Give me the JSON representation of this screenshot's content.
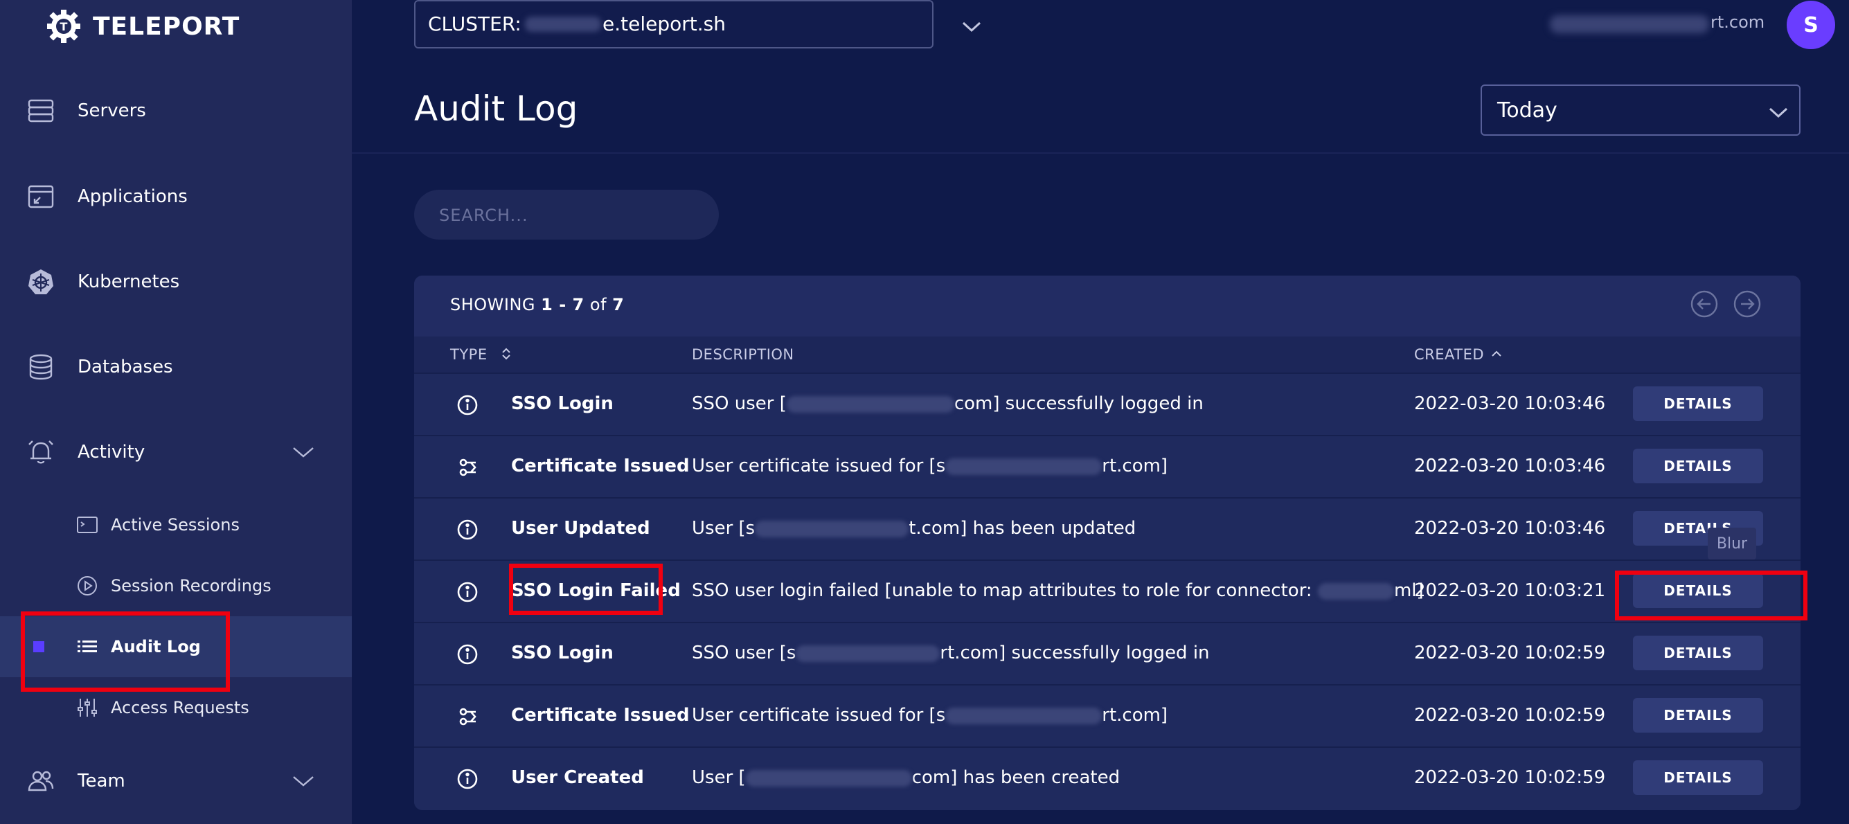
{
  "brand": {
    "name": "TELEPORT"
  },
  "sidebar": {
    "items": [
      {
        "label": "Servers",
        "icon": "server-icon"
      },
      {
        "label": "Applications",
        "icon": "application-icon"
      },
      {
        "label": "Kubernetes",
        "icon": "kubernetes-icon"
      },
      {
        "label": "Databases",
        "icon": "database-icon"
      },
      {
        "label": "Activity",
        "icon": "bell-icon",
        "expanded": true
      },
      {
        "label": "Team",
        "icon": "team-icon"
      }
    ],
    "activity_sub": [
      {
        "label": "Active Sessions",
        "icon": "terminal-icon"
      },
      {
        "label": "Session Recordings",
        "icon": "play-icon"
      },
      {
        "label": "Audit Log",
        "icon": "list-icon",
        "active": true
      },
      {
        "label": "Access Requests",
        "icon": "sliders-icon"
      }
    ]
  },
  "header": {
    "cluster_label": "CLUSTER:",
    "cluster_value": "e.teleport.sh",
    "user_email": "rt.com",
    "avatar_initial": "S"
  },
  "page": {
    "title": "Audit Log",
    "date_range": "Today",
    "search_placeholder": "SEARCH..."
  },
  "table": {
    "showing_prefix": "SHOWING",
    "range": "1 - 7",
    "of": "of",
    "total": "7",
    "columns": {
      "type": "TYPE",
      "description": "DESCRIPTION",
      "created": "CREATED"
    },
    "details_label": "DETAILS",
    "rows": [
      {
        "icon": "info-icon",
        "type": "SSO Login",
        "desc_pre": "SSO user [",
        "desc_post": "com] successfully logged in",
        "created": "2022-03-20 10:03:46"
      },
      {
        "icon": "certificate-icon",
        "type": "Certificate Issued",
        "desc_pre": "User certificate issued for [s",
        "desc_post": "rt.com]",
        "created": "2022-03-20 10:03:46"
      },
      {
        "icon": "info-icon",
        "type": "User Updated",
        "desc_pre": "User [s",
        "desc_post": "t.com] has been updated",
        "created": "2022-03-20 10:03:46"
      },
      {
        "icon": "info-icon",
        "type": "SSO Login Failed",
        "desc_pre": "SSO user login failed [unable to map attributes to role for connector: ",
        "desc_post": "ml]",
        "created": "2022-03-20 10:03:21"
      },
      {
        "icon": "info-icon",
        "type": "SSO Login",
        "desc_pre": "SSO user [s",
        "desc_post": "rt.com] successfully logged in",
        "created": "2022-03-20 10:02:59"
      },
      {
        "icon": "certificate-icon",
        "type": "Certificate Issued",
        "desc_pre": "User certificate issued for [s",
        "desc_post": "rt.com]",
        "created": "2022-03-20 10:02:59"
      },
      {
        "icon": "info-icon",
        "type": "User Created",
        "desc_pre": "User [",
        "desc_post": "com] has been created",
        "created": "2022-03-20 10:02:59"
      }
    ]
  },
  "tooltip": "Blur",
  "colors": {
    "accent": "#5a3dff",
    "highlight": "#f00010",
    "background": "#0f1a4a",
    "sidebar": "#21295a"
  }
}
